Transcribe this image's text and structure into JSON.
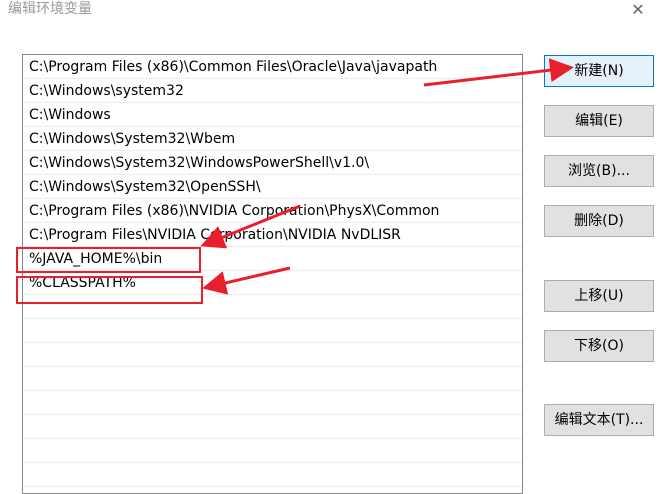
{
  "window": {
    "title": "编辑环境变量",
    "close_glyph": "✕"
  },
  "path_list": {
    "items": [
      "C:\\Program Files (x86)\\Common Files\\Oracle\\Java\\javapath",
      "C:\\Windows\\system32",
      "C:\\Windows",
      "C:\\Windows\\System32\\Wbem",
      "C:\\Windows\\System32\\WindowsPowerShell\\v1.0\\",
      "C:\\Windows\\System32\\OpenSSH\\",
      "C:\\Program Files (x86)\\NVIDIA Corporation\\PhysX\\Common",
      "C:\\Program Files\\NVIDIA Corporation\\NVIDIA NvDLISR",
      "%JAVA_HOME%\\bin",
      "%CLASSPATH%",
      "",
      "",
      "",
      "",
      "",
      "",
      "",
      ""
    ]
  },
  "buttons": {
    "new": "新建(N)",
    "edit": "编辑(E)",
    "browse": "浏览(B)...",
    "delete": "删除(D)",
    "move_up": "上移(U)",
    "move_down": "下移(O)",
    "edit_text": "编辑文本(T)..."
  },
  "colors": {
    "annotation": "#e8202b",
    "primary_border": "#0078d7"
  }
}
